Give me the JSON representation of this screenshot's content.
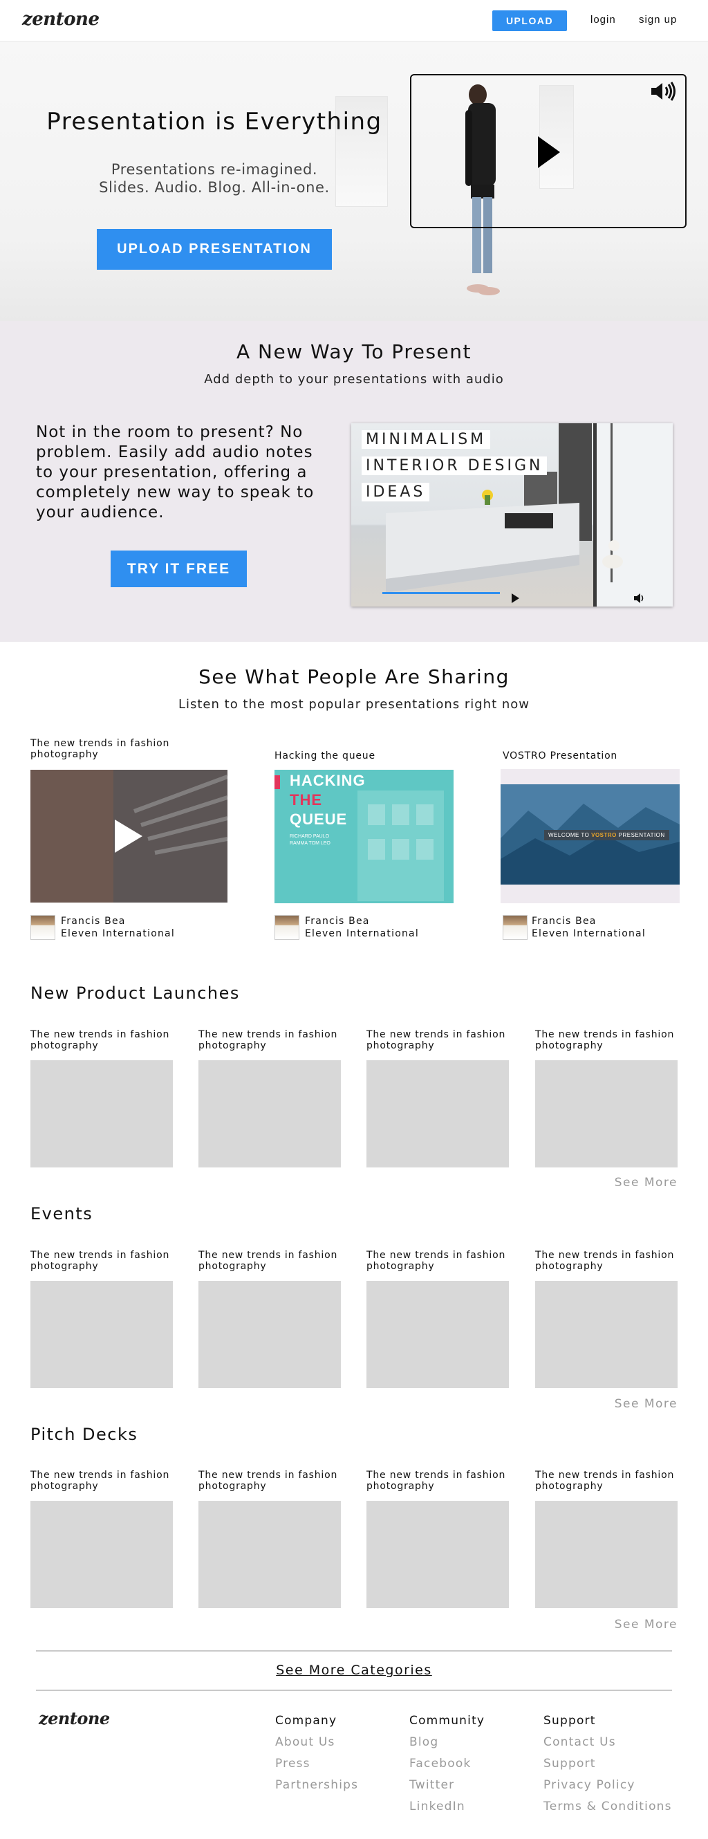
{
  "nav": {
    "logo": "zentone",
    "upload_label": "UPLOAD",
    "login_label": "login",
    "signup_label": "sign up"
  },
  "hero": {
    "title": "Presentation is Everything",
    "subtitle_line1": "Presentations re-imagined.",
    "subtitle_line2": "Slides. Audio. Blog. All-in-one.",
    "cta_label": "UPLOAD PRESENTATION"
  },
  "new_way": {
    "title": "A New Way To Present",
    "subtitle": "Add depth to your presentations with audio",
    "body_lines": [
      "Not in the room to present? No",
      "problem. Easily add audio notes",
      "to your presentation, offering a",
      "completely new way to speak to",
      "your audience."
    ],
    "cta_label": "TRY IT FREE",
    "video_labels": [
      "MINIMALISM",
      "INTERIOR DESIGN",
      "IDEAS"
    ]
  },
  "sharing": {
    "title": "See What People Are Sharing",
    "subtitle": "Listen to the most popular presentations right now",
    "cards": [
      {
        "title_line1": "The new trends in fashion",
        "title_line2": "photography",
        "author": "Francis Bea",
        "org": "Eleven International"
      },
      {
        "title_line1": "Hacking the queue",
        "title_line2": "",
        "author": "Francis Bea",
        "org": "Eleven International",
        "thumb_text": [
          "HACKING",
          "THE",
          "QUEUE"
        ],
        "thumb_names": "RICHARD PAULO RAMMA TOM LEO"
      },
      {
        "title_line1": "VOSTRO Presentation",
        "title_line2": "",
        "author": "Francis Bea",
        "org": "Eleven International",
        "thumb_text_a": "WELCOME TO",
        "thumb_text_b": "VOSTRO",
        "thumb_text_c": "PRESENTATION"
      }
    ]
  },
  "categories": [
    {
      "title": "New Product Launches",
      "see_more": "See More",
      "items": [
        "The new trends in fashion photography",
        "The new trends in fashion photography",
        "The new trends in fashion photography",
        "The new trends in fashion photography"
      ]
    },
    {
      "title": "Events",
      "see_more": "See More",
      "items": [
        "The new trends in fashion photography",
        "The new trends in fashion photography",
        "The new trends in fashion photography",
        "The new trends in fashion photography"
      ]
    },
    {
      "title": "Pitch Decks",
      "see_more": "See More",
      "items": [
        "The new trends in fashion photography",
        "The new trends in fashion photography",
        "The new trends in fashion photography",
        "The new trends in fashion photography"
      ]
    }
  ],
  "item_line1": "The new trends in fashion",
  "item_line2": "photography",
  "see_more_categories": "See More Categories",
  "footer": {
    "logo": "zentone",
    "columns": [
      {
        "heading": "Company",
        "links": [
          "About Us",
          "Press",
          "Partnerships"
        ]
      },
      {
        "heading": "Community",
        "links": [
          "Blog",
          "Facebook",
          "Twitter",
          "LinkedIn"
        ]
      },
      {
        "heading": "Support",
        "links": [
          "Contact Us",
          "Support",
          "Privacy Policy",
          "Terms & Conditions"
        ]
      }
    ]
  },
  "colors": {
    "accent": "#2f8ff0",
    "section_bg": "#ede9ee",
    "placeholder": "#d8d8d8",
    "muted_text": "#9a9a9a"
  }
}
